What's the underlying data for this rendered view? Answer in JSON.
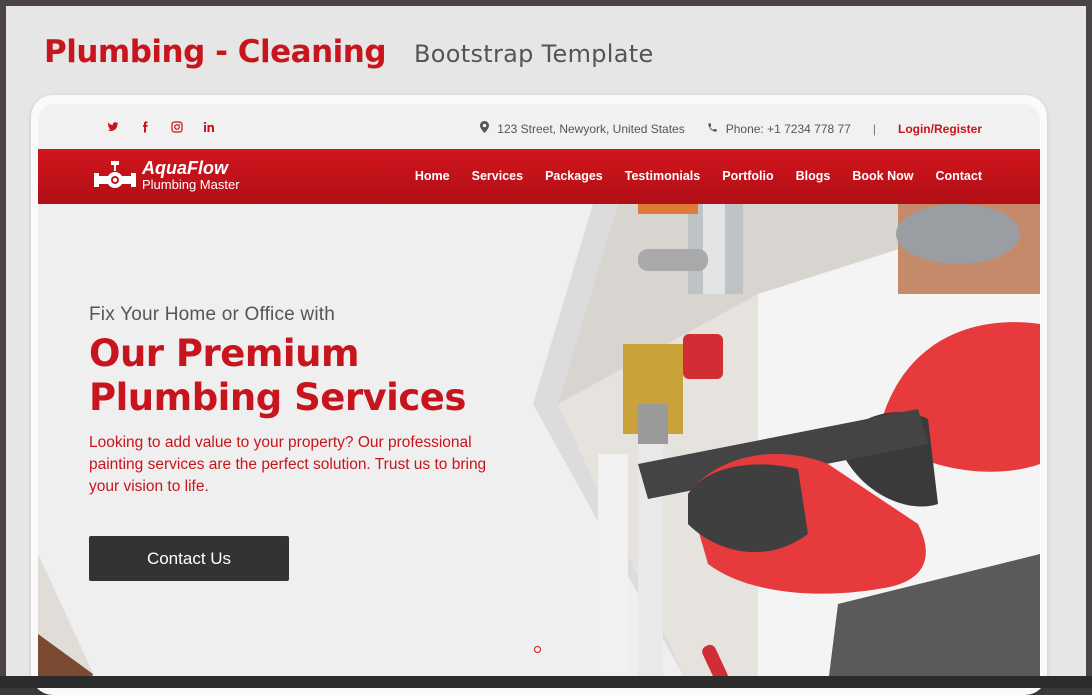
{
  "preview": {
    "title": "Plumbing - Cleaning",
    "subtitle": "Bootstrap Template"
  },
  "topbar": {
    "social_icons": [
      "twitter-icon",
      "facebook-icon",
      "instagram-icon",
      "linkedin-icon"
    ],
    "address": "123 Street, Newyork, United States",
    "phone": "Phone: +1 7234 778 77",
    "separator": "|",
    "login": "Login/Register"
  },
  "brand": {
    "name": "AquaFlow",
    "tagline": "Plumbing Master"
  },
  "nav": {
    "items": [
      "Home",
      "Services",
      "Packages",
      "Testimonials",
      "Portfolio",
      "Blogs",
      "Book Now",
      "Contact"
    ]
  },
  "hero": {
    "kicker": "Fix Your Home or Office with",
    "headline_line1": "Our Premium",
    "headline_line2": "Plumbing Services",
    "lead": "Looking to add value to your property? Our professional painting services are the perfect solution. Trust us to bring your vision to life.",
    "cta": "Contact Us",
    "slides": 2,
    "active_slide": 1
  },
  "colors": {
    "brand_red": "#c8141c",
    "button_dark": "#333333",
    "page_bg": "#efefef"
  }
}
